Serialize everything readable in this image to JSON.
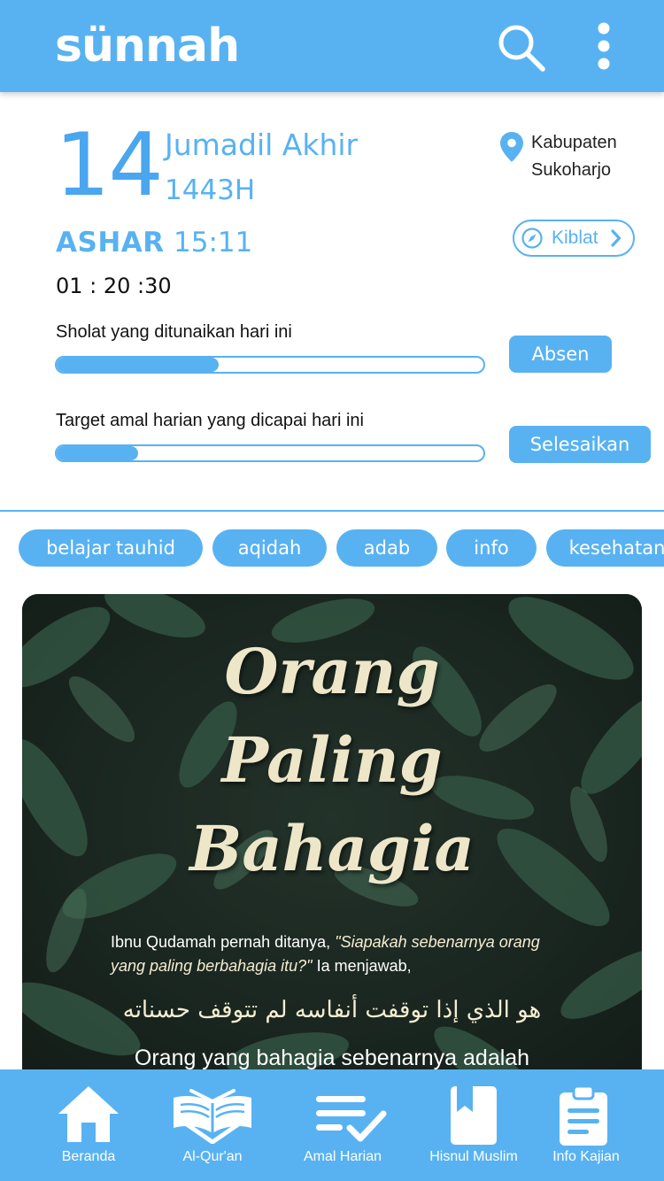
{
  "header": {
    "logo_text": "sünnah",
    "search_icon": "search-icon",
    "menu_icon": "more-vertical-icon",
    "color": "#58b2f2"
  },
  "date": {
    "day": "14",
    "month": "Jumadil Akhir",
    "year": "1443H"
  },
  "location": {
    "icon": "location-pin-icon",
    "text": "Kabupaten\nSukoharjo"
  },
  "prayer": {
    "name": "ASHAR",
    "time": "15:11",
    "countdown": "01 : 20 :30"
  },
  "kiblat": {
    "label": "Kiblat",
    "icon": "compass-icon"
  },
  "progress": [
    {
      "label": "Sholat yang ditunaikan hari ini",
      "percent": 38,
      "button": "Absen"
    },
    {
      "label": "Target amal harian yang dicapai hari ini",
      "percent": 19,
      "button": "Selesaikan"
    }
  ],
  "tags": [
    "belajar tauhid",
    "aqidah",
    "adab",
    "info",
    "kesehatan"
  ],
  "feature": {
    "title_lines": [
      "Orang",
      "Paling",
      "Bahagia"
    ],
    "quote_intro": "Ibnu Qudamah pernah ditanya, ",
    "quote_question": "\"Siapakah sebenarnya orang yang paling berbahagia itu?\"",
    "quote_outro": " Ia menjawab,",
    "arabic": "هو الذي إذا توقفت أنفاسه لم تتوقف حسناته",
    "latin": "Orang yang bahagia sebenarnya adalah"
  },
  "nav": [
    {
      "label": "Beranda",
      "icon": "home-icon"
    },
    {
      "label": "Al-Qur'an",
      "icon": "quran-icon"
    },
    {
      "label": "Amal Harian",
      "icon": "checklist-icon"
    },
    {
      "label": "Hisnul Muslim",
      "icon": "book-bookmark-icon"
    },
    {
      "label": "Info Kajian",
      "icon": "clipboard-icon"
    }
  ],
  "colors": {
    "primary": "#58b2f2",
    "accent_day": "#4aa6ee",
    "card_text": "#eee6c8"
  }
}
